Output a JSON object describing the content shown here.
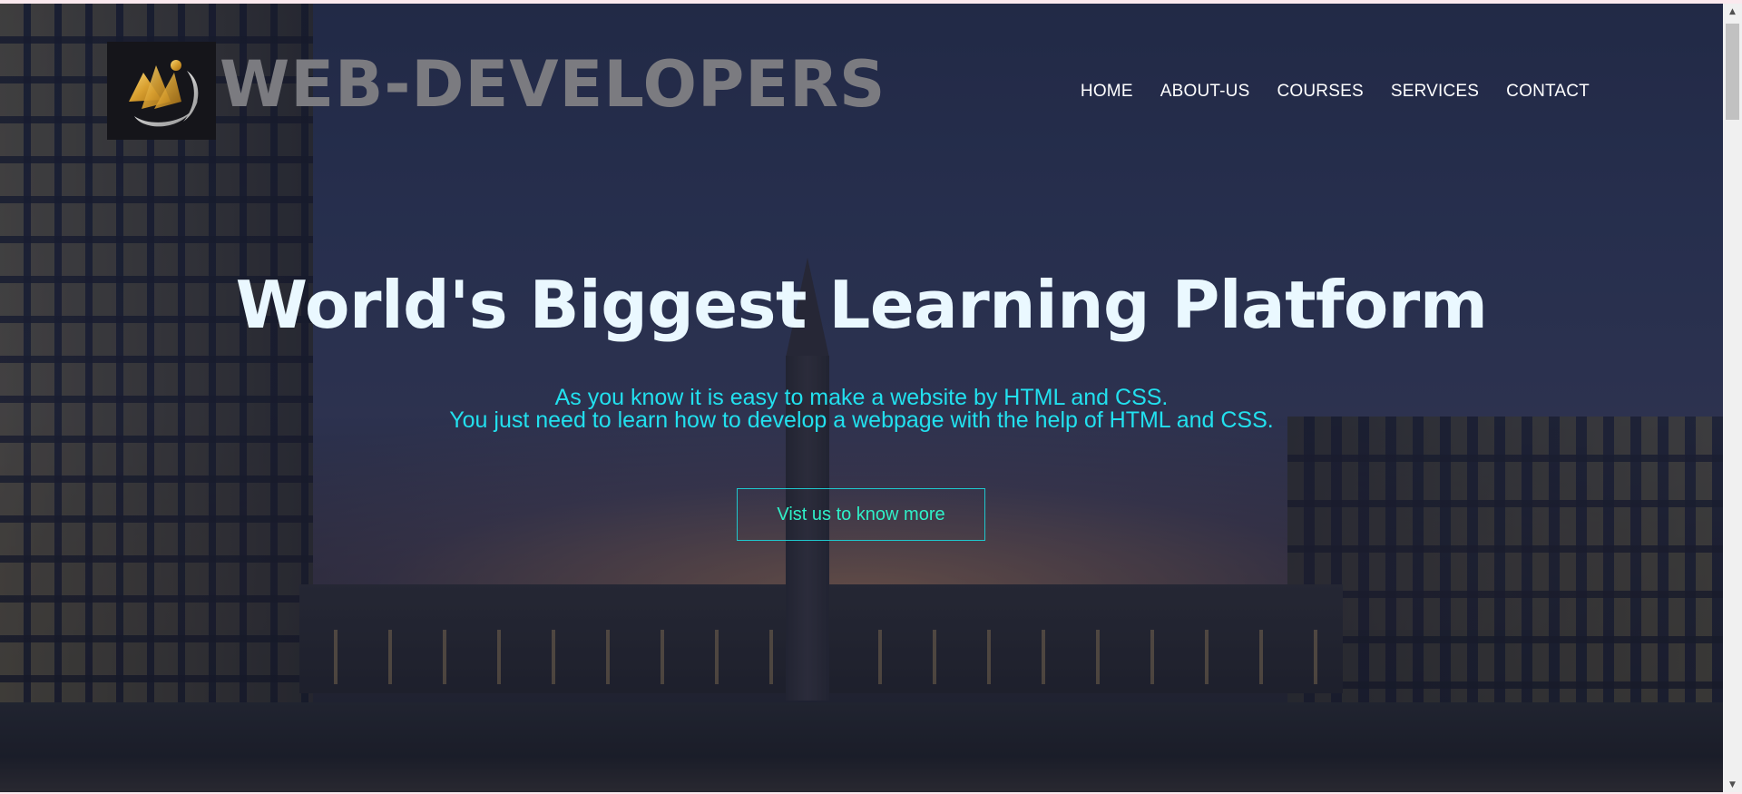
{
  "brand": {
    "logo_icon": "book-logo-icon",
    "name": "WEB-DEVELOPERS"
  },
  "nav": {
    "items": [
      {
        "label": "HOME"
      },
      {
        "label": "ABOUT-US"
      },
      {
        "label": "COURSES"
      },
      {
        "label": "SERVICES"
      },
      {
        "label": "CONTACT"
      }
    ]
  },
  "hero": {
    "title": "World's Biggest Learning Platform",
    "subtitle_line1": "As you know it is easy to make a website by HTML and CSS.",
    "subtitle_line2": "You just need to learn how to develop a webpage with the help of HTML and CSS.",
    "cta_label": "Vist us to know more"
  },
  "colors": {
    "title": "#eaf8ff",
    "subtitle": "#22e0ee",
    "cta_border": "#1fc7cd",
    "cta_text": "#2ff0c8",
    "brand_text": "#7b7b80",
    "page_border": "#fbe9ee"
  },
  "scrollbar": {
    "up_icon": "scroll-up-arrow-icon",
    "down_icon": "scroll-down-arrow-icon"
  }
}
